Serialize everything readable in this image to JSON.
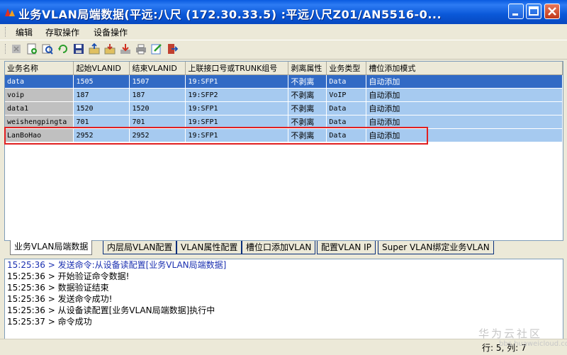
{
  "window": {
    "title": "业务VLAN局端数据(平远:八尺 (172.30.33.5) :平远八尺Z01/AN5516-0...",
    "minimize_icon": "minimize-icon",
    "maximize_icon": "maximize-icon",
    "close_icon": "close-icon"
  },
  "menu": [
    "编辑",
    "存取操作",
    "设备操作"
  ],
  "toolbar": {
    "icons": [
      "delete-icon",
      "add-icon",
      "query-icon",
      "refresh-icon",
      "save-icon",
      "export-icon",
      "import-icon",
      "download-icon",
      "print-icon",
      "edit-icon",
      "exit-icon"
    ]
  },
  "grid": {
    "columns": [
      "业务名称",
      "起始VLANID",
      "结束VLANID",
      "上联接口号或TRUNK组号",
      "剥离属性",
      "业务类型",
      "槽位添加模式"
    ],
    "rows": [
      {
        "name": "data",
        "start": "1505",
        "end": "1507",
        "uplink": "19:SFP1",
        "strip": "不剥离",
        "type": "Data",
        "mode": "自动添加",
        "selected": true
      },
      {
        "name": "voip",
        "start": "187",
        "end": "187",
        "uplink": "19:SFP2",
        "strip": "不剥离",
        "type": "VoIP",
        "mode": "自动添加",
        "selected": false
      },
      {
        "name": "data1",
        "start": "1520",
        "end": "1520",
        "uplink": "19:SFP1",
        "strip": "不剥离",
        "type": "Data",
        "mode": "自动添加",
        "selected": false
      },
      {
        "name": "weishengpingta",
        "start": "701",
        "end": "701",
        "uplink": "19:SFP1",
        "strip": "不剥离",
        "type": "Data",
        "mode": "自动添加",
        "selected": false
      },
      {
        "name": "LanBoHao",
        "start": "2952",
        "end": "2952",
        "uplink": "19:SFP1",
        "strip": "不剥离",
        "type": "Data",
        "mode": "自动添加",
        "selected": false
      }
    ]
  },
  "tabs": [
    "业务VLAN局端数据",
    "内层局VLAN配置",
    "VLAN属性配置",
    "槽位口添加VLAN",
    "配置VLAN IP",
    "Super VLAN绑定业务VLAN"
  ],
  "log": [
    "15:25:36 > 发送命令:从设备读配置[业务VLAN局端数据]",
    "15:25:36 > 开始验证命令数据!",
    "15:25:36 > 数据验证结束",
    "15:25:36 > 发送命令成功!",
    "15:25:36 > 从设备读配置[业务VLAN局端数据]执行中",
    "15:25:37 > 命令成功"
  ],
  "status": "行: 5, 列: 7",
  "watermark": {
    "text": "华为云社区",
    "sub": "bbs.huaweicloud.com"
  }
}
